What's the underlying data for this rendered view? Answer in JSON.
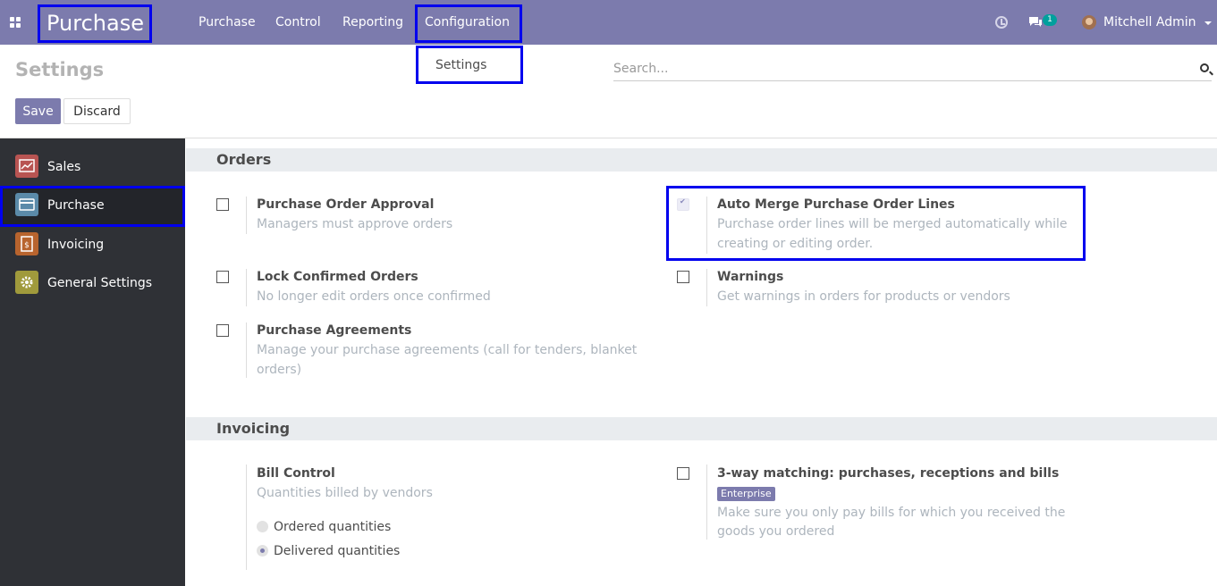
{
  "topbar": {
    "app_name": "Purchase",
    "menu": [
      "Purchase",
      "Control",
      "Reporting"
    ],
    "config_menu": "Configuration",
    "dropdown_item": "Settings",
    "notification_count": "1",
    "user_name": "Mitchell Admin"
  },
  "page": {
    "title": "Settings",
    "search_placeholder": "Search...",
    "save_label": "Save",
    "discard_label": "Discard"
  },
  "sidebar": {
    "items": [
      {
        "label": "Sales",
        "icon": "sales-icon",
        "color": "#b85452"
      },
      {
        "label": "Purchase",
        "icon": "purchase-icon",
        "color": "#5b8aa9"
      },
      {
        "label": "Invoicing",
        "icon": "invoicing-icon",
        "color": "#b8642e"
      },
      {
        "label": "General Settings",
        "icon": "gear-icon",
        "color": "#a09a3c"
      }
    ]
  },
  "orders": {
    "heading": "Orders",
    "approval": {
      "title": "Purchase Order Approval",
      "desc": "Managers must approve orders",
      "checked": false
    },
    "auto_merge": {
      "title": "Auto Merge Purchase Order Lines",
      "desc1": "Purchase order lines will be merged automatically while",
      "desc2": "creating or editing order.",
      "checked": true
    },
    "lock": {
      "title": "Lock Confirmed Orders",
      "desc": "No longer edit orders once confirmed",
      "checked": false
    },
    "warnings": {
      "title": "Warnings",
      "desc": "Get warnings in orders for products or vendors",
      "checked": false
    },
    "agreements": {
      "title": "Purchase Agreements",
      "desc1": "Manage your purchase agreements (call for tenders, blanket",
      "desc2": "orders)",
      "checked": false
    }
  },
  "invoicing": {
    "heading": "Invoicing",
    "bill_control": {
      "title": "Bill Control",
      "desc": "Quantities billed by vendors",
      "options": [
        "Ordered quantities",
        "Delivered quantities"
      ],
      "selected": "Delivered quantities"
    },
    "three_way": {
      "title": "3-way matching: purchases, receptions and bills",
      "badge": "Enterprise",
      "desc1": "Make sure you only pay bills for which you received the",
      "desc2": "goods you ordered",
      "checked": false
    }
  }
}
